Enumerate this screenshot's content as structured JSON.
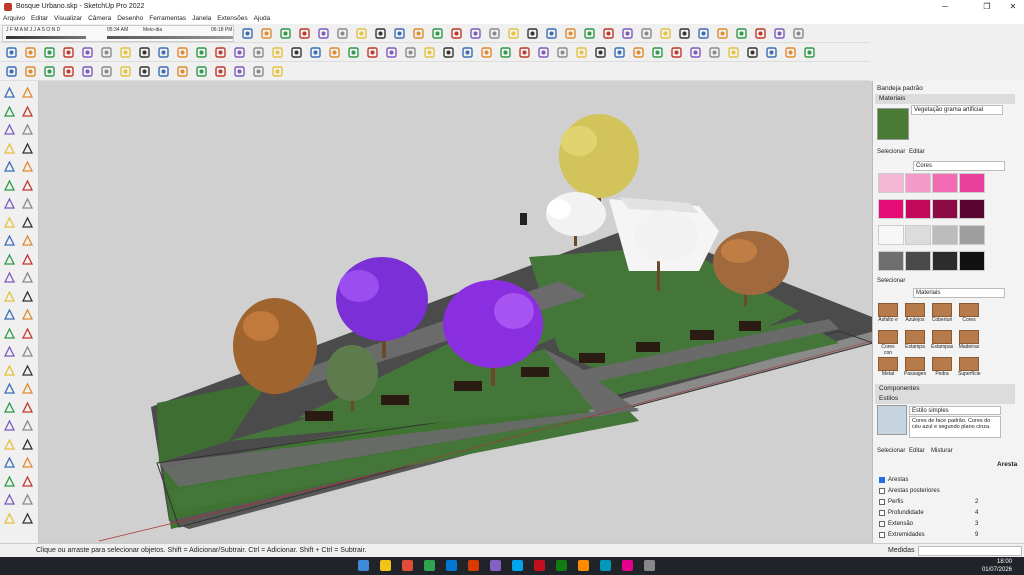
{
  "window": {
    "title": "Bosque Urbano.skp - SketchUp Pro 2022"
  },
  "menu": [
    "Arquivo",
    "Editar",
    "Visualizar",
    "Câmera",
    "Desenho",
    "Ferramentas",
    "Janela",
    "Extensões",
    "Ajuda"
  ],
  "shadow": {
    "months": "J F M A M J J A S O N D",
    "time_start": "05:34 AM",
    "time_mid": "Meio-dia",
    "time_end": "06:18 PM"
  },
  "tray": {
    "title": "Bandeja padrão",
    "materials": {
      "header": "Materiais",
      "current": "Vegetação grama artificial",
      "tabs": [
        "Selecionar",
        "Editar"
      ],
      "collection1": "Cores",
      "colors": [
        "#f4b8d4",
        "#f49ac8",
        "#f26bb3",
        "#e8409a",
        "#e60e76",
        "#c4095c",
        "#8c0b44",
        "#5a0630",
        "#f7f7f7",
        "#dcdcdc",
        "#bcbcbc",
        "#9e9e9e",
        "#6f6f6f",
        "#4a4a4a",
        "#2c2c2c",
        "#111111"
      ],
      "sel_label": "Selecionar",
      "collection2": "Materiais",
      "folders": [
        "Asfalto e",
        "Azulejos",
        "Coberturi",
        "Cores",
        "Cores con",
        "Estampa",
        "Estampas",
        "Madeiras",
        "Metal",
        "Passagen",
        "Pedra",
        "Superfície"
      ]
    },
    "components": {
      "header": "Componentes"
    },
    "styles": {
      "header": "Estilos",
      "name": "Estilo simples",
      "desc": "Cores de face padrão. Cores do céu azul e segundo plano cinza.",
      "tabs": [
        "Selecionar",
        "Editar",
        "Misturar"
      ],
      "section": "Aresta",
      "options": [
        {
          "label": "Arestas",
          "checked": true,
          "value": ""
        },
        {
          "label": "Arestas posteriores",
          "checked": false,
          "value": ""
        },
        {
          "label": "Perfis",
          "checked": false,
          "value": "2"
        },
        {
          "label": "Profundidade",
          "checked": false,
          "value": "4"
        },
        {
          "label": "Extensão",
          "checked": false,
          "value": "3"
        },
        {
          "label": "Extremidades",
          "checked": false,
          "value": "9"
        }
      ]
    }
  },
  "status": {
    "hint": "Clique ou arraste para selecionar objetos. Shift = Adicionar/Subtrair. Ctrl = Adicionar. Shift + Ctrl = Subtrair.",
    "measure_label": "Medidas"
  },
  "taskbar": {
    "time": "18:00",
    "date": "01/07/2026"
  }
}
